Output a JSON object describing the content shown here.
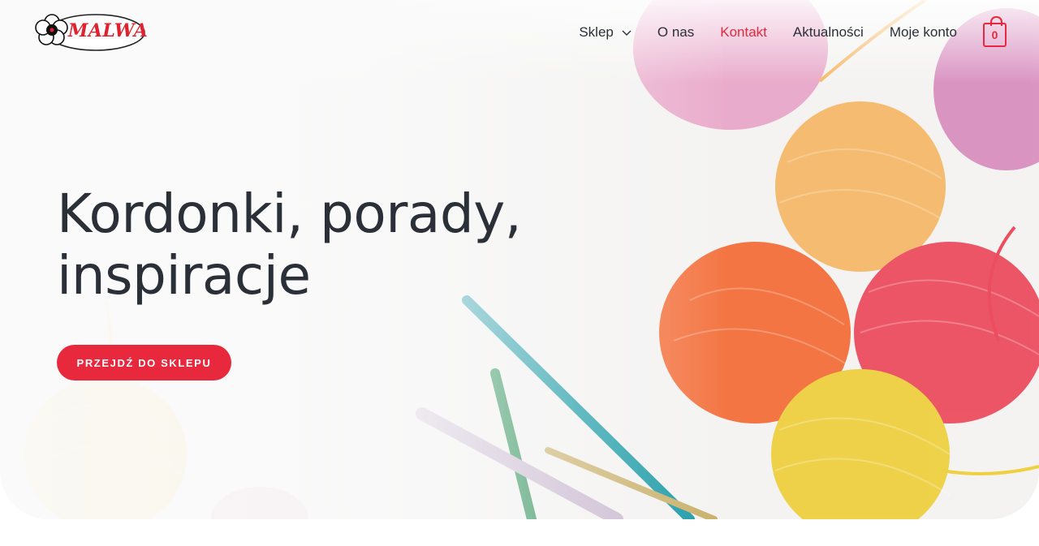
{
  "header": {
    "logo_text": "MALWA",
    "nav": [
      {
        "label": "Sklep",
        "has_submenu": true
      },
      {
        "label": "O nas"
      },
      {
        "label": "Kontakt",
        "active": true
      },
      {
        "label": "Aktualności"
      },
      {
        "label": "Moje konto"
      }
    ],
    "cart_count": "0"
  },
  "hero": {
    "headline_line1": "Kordonki, porady,",
    "headline_line2": "inspiracje",
    "cta_label": "PRZEJDŹ DO SKLEPU"
  },
  "colors": {
    "accent": "#e8283c",
    "text": "#2b2f38",
    "background": "#ffffff"
  },
  "icons": [
    "flower-logo-icon",
    "chevron-down-icon",
    "shopping-bag-icon"
  ]
}
